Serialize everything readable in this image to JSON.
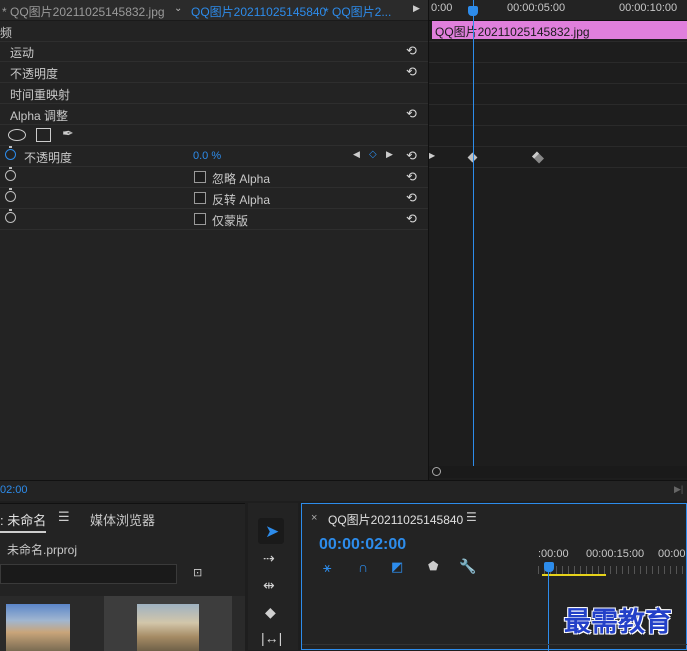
{
  "effect_controls": {
    "tabs": [
      "* QQ图片20211025145832.jpg",
      "QQ图片20211025145840",
      "* QQ图片2..."
    ],
    "tab_prefix": "频",
    "rows": {
      "motion": "运动",
      "opacity": "不透明度",
      "time_remap": "时间重映射",
      "alpha_adjust": "Alpha 调整",
      "opacity_prop": "不透明度",
      "opacity_value": "0.0 %",
      "ignore_alpha": "忽略 Alpha",
      "invert_alpha": "反转 Alpha",
      "mask_only": "仅蒙版"
    },
    "ruler": [
      "0:00",
      "00:00:05:00",
      "00:00:10:00"
    ],
    "clip_name": "QQ图片20211025145832.jpg",
    "current_time": "02:00"
  },
  "project": {
    "tab_project": ": 未命名",
    "tab_media_browser": "媒体浏览器",
    "file_name": "未命名.prproj"
  },
  "sequence": {
    "tab_name": "QQ图片20211025145840",
    "timecode": "00:00:02:00",
    "ruler": [
      ":00:00",
      "00:00:15:00",
      "00:00"
    ]
  },
  "watermark": "最需教育"
}
